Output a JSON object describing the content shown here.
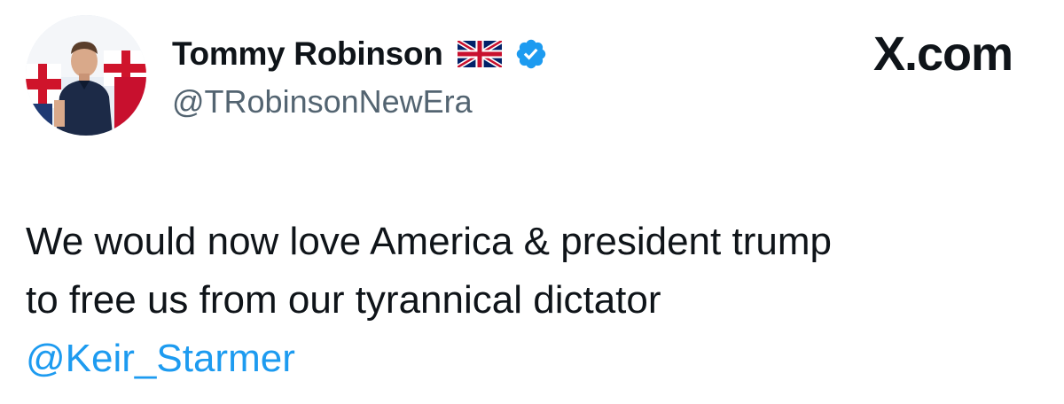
{
  "author": {
    "display_name": "Tommy Robinson",
    "handle": "@TRobinsonNewEra",
    "flag_icon": "uk-flag-icon",
    "verified_icon": "verified-badge-icon",
    "verified_color": "#1d9bf0"
  },
  "brand": {
    "label": "X.com"
  },
  "tweet": {
    "text_lines": [
      "We would now love America & president trump",
      "to free us from our tyrannical dictator"
    ],
    "mention": "@Keir_Starmer",
    "mention_color": "#1d9bf0"
  }
}
